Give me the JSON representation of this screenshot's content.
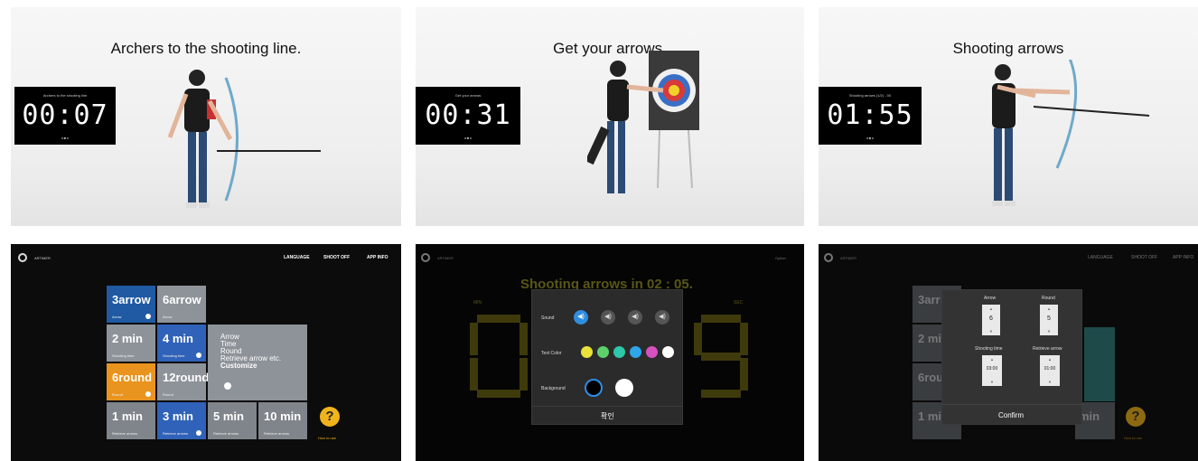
{
  "top_row": [
    {
      "caption": "Archers to the shooting line.",
      "timer_label": "Archers to the shooting line",
      "timer": "00:07"
    },
    {
      "caption": "Get your arrows.",
      "timer_label": "Get your arrows",
      "timer": "00:31"
    },
    {
      "caption": "Shooting arrows",
      "timer_label": "Shooting arrows (1/2) - 00",
      "timer": "01:55"
    }
  ],
  "screen1": {
    "brand": "ARTIMER",
    "menu": [
      "LANGUAGE",
      "SHOOT OFF",
      "APP INFO"
    ],
    "tiles": [
      {
        "big": "3arrow",
        "small": "Arrow",
        "color": "#1f5aa3"
      },
      {
        "big": "6arrow",
        "small": "Arrow",
        "color": "#8d9399"
      },
      {
        "big": "2 min",
        "small": "Shooting time",
        "color": "#8d9399"
      },
      {
        "big": "4 min",
        "small": "Shooting time",
        "color": "#2f62b8"
      },
      {
        "big": "6round",
        "small": "Round",
        "color": "#e9941e"
      },
      {
        "big": "12round",
        "small": "Round",
        "color": "#8d9399"
      },
      {
        "big": "1 min",
        "small": "Retrieve arrows",
        "color": "#7f858b"
      },
      {
        "big": "3 min",
        "small": "Retrieve arrows",
        "color": "#2f62b8"
      },
      {
        "big": "5 min",
        "small": "Retrieve arrows",
        "color": "#7f858b"
      },
      {
        "big": "10 min",
        "small": "Retrieve arrows",
        "color": "#7f858b"
      }
    ],
    "info_lines": [
      "Arrow",
      "Time",
      "Round",
      "Retrieve arrow etc."
    ],
    "customize": "Customize",
    "help_symbol": "?",
    "help_label": "How to use"
  },
  "screen2": {
    "brand": "ARTIMER",
    "options": "Option",
    "heading": "Shooting arrows in 02 : 05.",
    "left_label": "MIN",
    "right_label": "SEC",
    "sound_label": "Sound",
    "text_color_label": "Text Color",
    "background_label": "Background",
    "confirm": "확인",
    "text_colors": [
      "#e8e23a",
      "#5dd06a",
      "#2ec7a8",
      "#2fa6e8",
      "#d651c0",
      "#ffffff"
    ],
    "bg_colors": [
      "#000000",
      "#ffffff"
    ],
    "accent": "#2f8de0"
  },
  "screen3": {
    "brand": "ARTIMER",
    "menu": [
      "LANGUAGE",
      "SHOOT OFF",
      "APP INFO"
    ],
    "steppers": [
      {
        "label": "Arrow",
        "value": "6"
      },
      {
        "label": "Round",
        "value": "5"
      },
      {
        "label": "Shooting time",
        "value": "03:00"
      },
      {
        "label": "Retrieve arrow",
        "value": "01:00"
      }
    ],
    "confirm": "Confirm",
    "bg_tiles": [
      "3arr",
      "2 mi",
      "6rou",
      "1 mi",
      "min"
    ],
    "help_symbol": "?",
    "help_label": "How to use"
  }
}
